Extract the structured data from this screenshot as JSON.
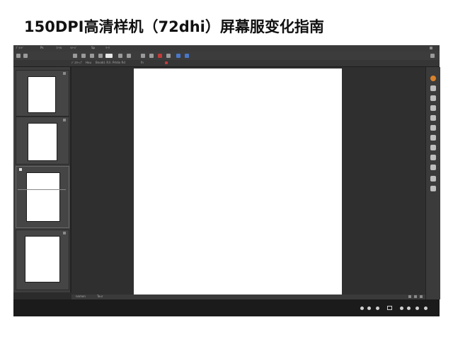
{
  "headline": "150DPI高清样机（72dhi）屏幕服变化指南",
  "app": {
    "menu": [
      "ﾌﾞﾗﾝﾄﾞ",
      "Ps",
      "ﾌｧｲﾙ",
      "ｲﾒｰｼﾞ",
      "Sp",
      "ﾏｰｸ"
    ],
    "options_bar": [
      "ﾃﾞｽｸﾄｯﾌﾟ",
      "Hou",
      "Bnodd. R.ll.",
      "Prldin Rd",
      "fn"
    ],
    "status": [
      "nomen",
      "Tour"
    ],
    "accent_colors": {
      "orange": "#d9822b",
      "red": "#c23a3a",
      "blue": "#4a77c9"
    }
  }
}
